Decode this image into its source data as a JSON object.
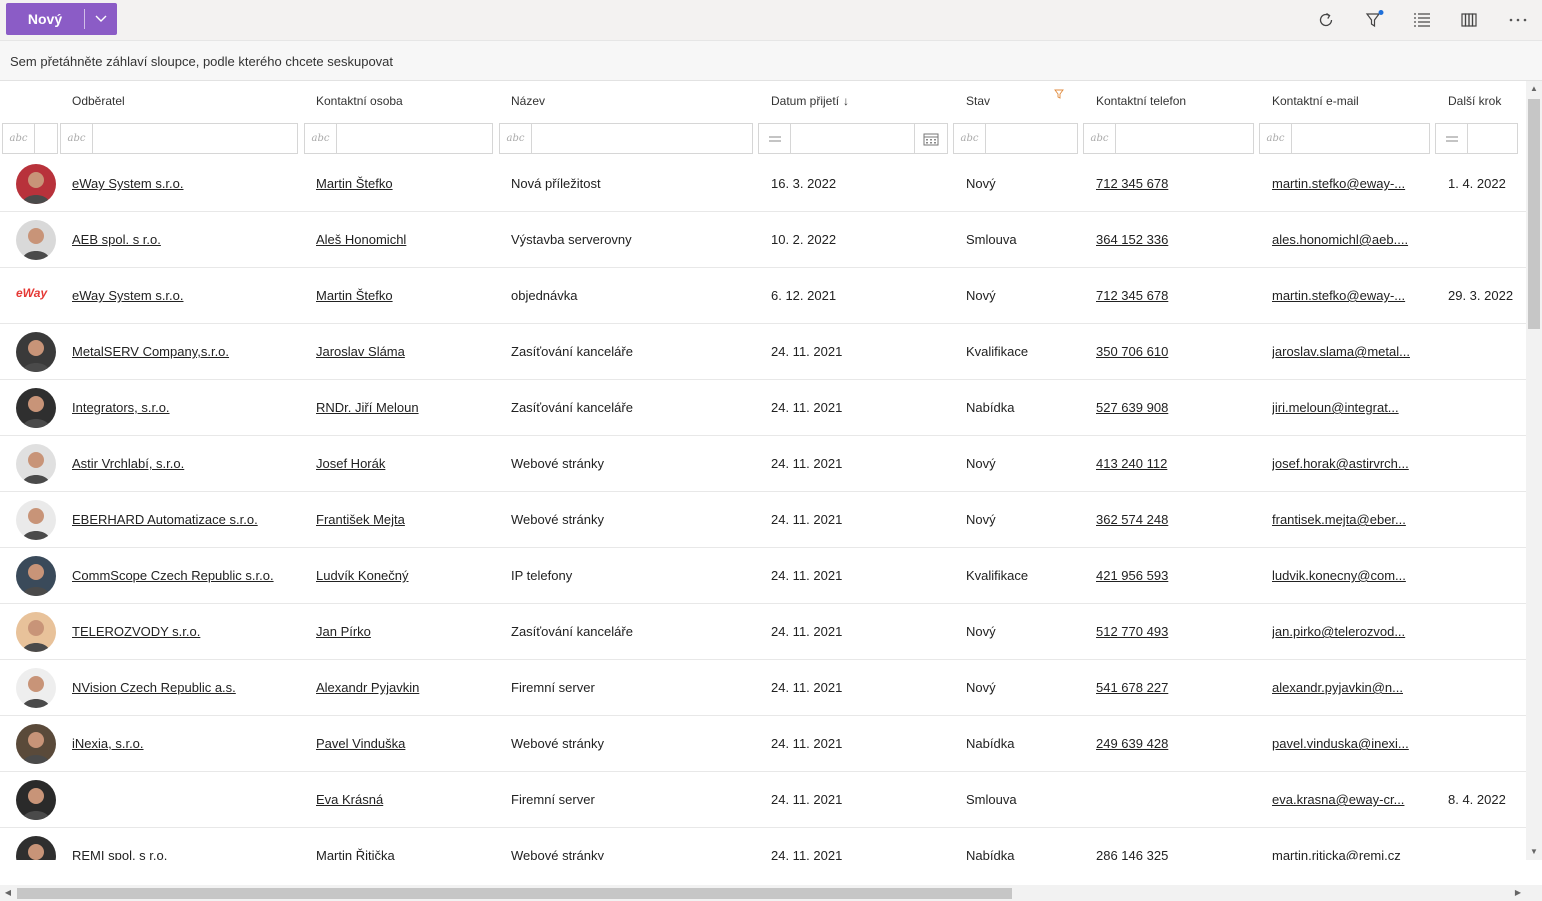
{
  "toolbar": {
    "new_label": "Nový",
    "icons": [
      "refresh-icon",
      "filter-icon",
      "list-icon",
      "columns-icon",
      "more-icon"
    ],
    "accent": "#8b5cc6",
    "filter_badge_color": "#1e6fd9"
  },
  "groupbar": {
    "text": "Sem přetáhněte záhlaví sloupce, podle kterého chcete seskupovat"
  },
  "columns": {
    "customer": "Odběratel",
    "contact": "Kontaktní osoba",
    "name": "Název",
    "date": "Datum přijetí",
    "status": "Stav",
    "phone": "Kontaktní telefon",
    "email": "Kontaktní e-mail",
    "next": "Další krok"
  },
  "rows": [
    {
      "avatar": "photo",
      "customer": "eWay System s.r.o.",
      "contact": "Martin Štefko",
      "name": "Nová příležitost",
      "date": "16. 3. 2022",
      "status": "Nový",
      "phone": "712 345 678",
      "email": "martin.stefko@eway-...",
      "next": "1. 4. 2022"
    },
    {
      "avatar": "photo",
      "customer": "AEB spol. s r.o.",
      "contact": "Aleš Honomichl",
      "name": "Výstavba serverovny",
      "date": "10. 2. 2022",
      "status": "Smlouva",
      "phone": "364 152 336",
      "email": "ales.honomichl@aeb....",
      "next": ""
    },
    {
      "avatar": "logo",
      "logo_text": "eWay",
      "customer": "eWay System s.r.o.",
      "contact": "Martin Štefko",
      "name": "objednávka",
      "date": "6. 12. 2021",
      "status": "Nový",
      "phone": "712 345 678",
      "email": "martin.stefko@eway-...",
      "next": "29. 3. 2022"
    },
    {
      "avatar": "photo",
      "customer": "MetalSERV Company,s.r.o.",
      "contact": "Jaroslav Sláma",
      "name": "Zasíťování kanceláře",
      "date": "24. 11. 2021",
      "status": "Kvalifikace",
      "phone": "350 706 610",
      "email": "jaroslav.slama@metal...",
      "next": ""
    },
    {
      "avatar": "photo",
      "customer": "Integrators, s.r.o.",
      "contact": "RNDr. Jiří Meloun",
      "name": "Zasíťování kanceláře",
      "date": "24. 11. 2021",
      "status": "Nabídka",
      "phone": "527 639 908",
      "email": "jiri.meloun@integrat...",
      "next": ""
    },
    {
      "avatar": "photo",
      "customer": "Astir Vrchlabí, s.r.o.",
      "contact": "Josef Horák",
      "name": "Webové stránky",
      "date": "24. 11. 2021",
      "status": "Nový",
      "phone": "413 240 112",
      "email": "josef.horak@astirvrch...",
      "next": ""
    },
    {
      "avatar": "photo",
      "customer": "EBERHARD Automatizace s.r.o.",
      "contact": "František Mejta",
      "name": "Webové stránky",
      "date": "24. 11. 2021",
      "status": "Nový",
      "phone": "362 574 248",
      "email": "frantisek.mejta@eber...",
      "next": ""
    },
    {
      "avatar": "photo",
      "customer": "CommScope Czech Republic s.r.o.",
      "contact": "Ludvík Konečný",
      "name": "IP telefony",
      "date": "24. 11. 2021",
      "status": "Kvalifikace",
      "phone": "421 956 593",
      "email": "ludvik.konecny@com...",
      "next": ""
    },
    {
      "avatar": "photo",
      "customer": "TELEROZVODY s.r.o.",
      "contact": "Jan Pírko",
      "name": "Zasíťování kanceláře",
      "date": "24. 11. 2021",
      "status": "Nový",
      "phone": "512 770 493",
      "email": "jan.pirko@telerozvod...",
      "next": ""
    },
    {
      "avatar": "photo",
      "customer": "NVision Czech Republic a.s.",
      "contact": "Alexandr Pyjavkin",
      "name": "Firemní server",
      "date": "24. 11. 2021",
      "status": "Nový",
      "phone": "541 678 227",
      "email": "alexandr.pyjavkin@n...",
      "next": ""
    },
    {
      "avatar": "photo",
      "customer": "iNexia, s.r.o.",
      "contact": "Pavel Vinduška",
      "name": "Webové stránky",
      "date": "24. 11. 2021",
      "status": "Nabídka",
      "phone": "249 639 428",
      "email": "pavel.vinduska@inexi...",
      "next": ""
    },
    {
      "avatar": "photo",
      "customer": "",
      "contact": "Eva Krásná",
      "name": "Firemní server",
      "date": "24. 11. 2021",
      "status": "Smlouva",
      "phone": "",
      "email": "eva.krasna@eway-cr...",
      "next": "8. 4. 2022"
    },
    {
      "avatar": "photo",
      "customer": "REMI spol. s r.o.",
      "contact": "Martin Řitička",
      "name": "Webové stránky",
      "date": "24. 11. 2021",
      "status": "Nabídka",
      "phone": "286 146 325",
      "email": "martin.riticka@remi.cz",
      "next": ""
    }
  ],
  "avatar_colors": [
    "#b8323b",
    "#d9d9d9",
    "#ffffff",
    "#3a3a3a",
    "#2f2f2f",
    "#e0e0e0",
    "#eaeaea",
    "#3a4a5a",
    "#e8c29a",
    "#eeeeee",
    "#5a4a3a",
    "#2a2a2a",
    "#2f2f2f"
  ]
}
